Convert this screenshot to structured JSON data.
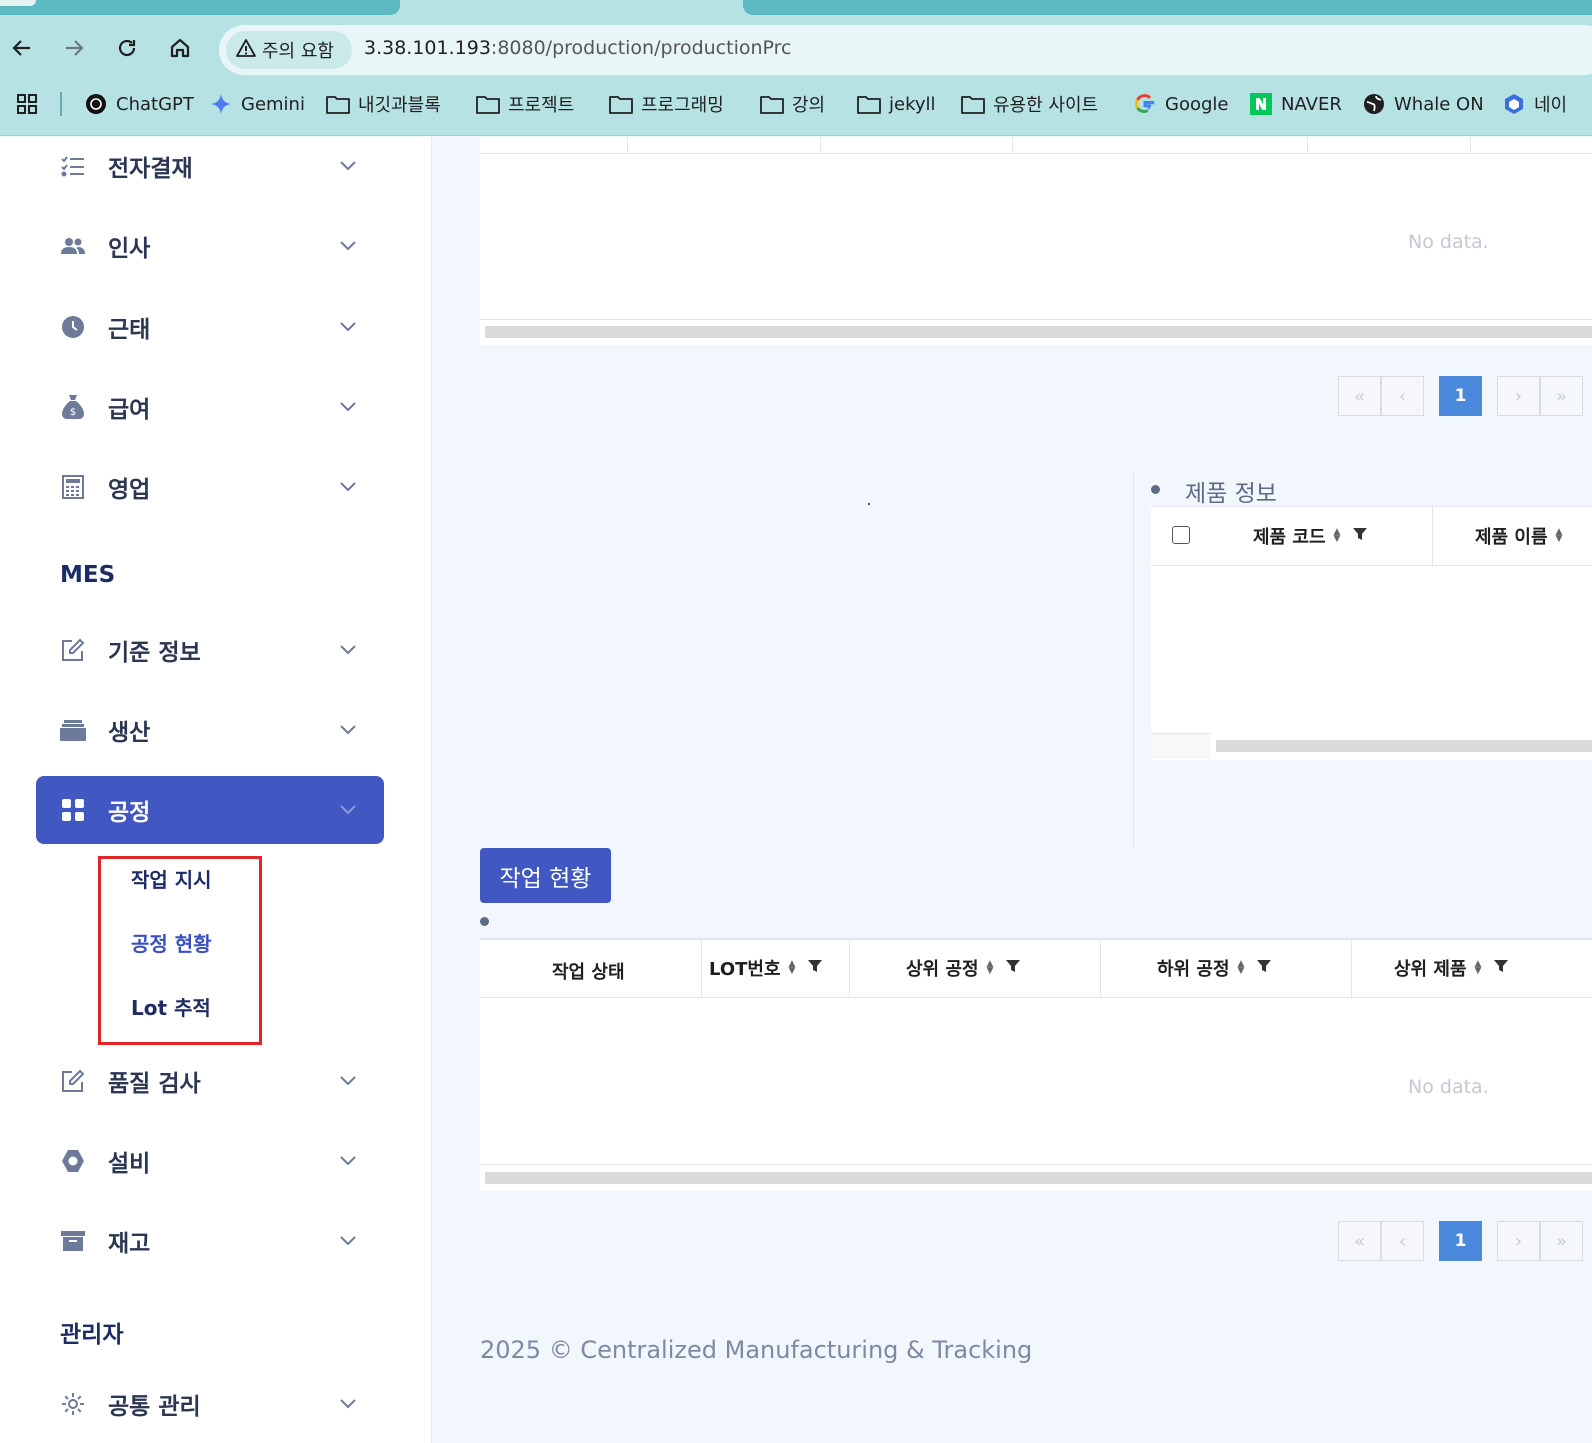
{
  "browser": {
    "security_chip": "주의 요함",
    "url_host": "3.38.101.193",
    "url_rest": ":8080/production/productionPrc",
    "bookmarks": [
      "ChatGPT",
      "Gemini",
      "내깃과블록",
      "프로젝트",
      "프로그래밍",
      "강의",
      "jekyll",
      "유용한 사이트",
      "Google",
      "NAVER",
      "Whale ON",
      "네이"
    ]
  },
  "sidebar": {
    "items_top": [
      {
        "label": "전자결재",
        "icon": "list-check-icon"
      },
      {
        "label": "인사",
        "icon": "users-icon"
      },
      {
        "label": "근태",
        "icon": "clock-icon"
      },
      {
        "label": "급여",
        "icon": "money-bag-icon"
      },
      {
        "label": "영업",
        "icon": "calculator-icon"
      }
    ],
    "section_mes": "MES",
    "items_mes": [
      {
        "label": "기준 정보",
        "icon": "edit-icon"
      },
      {
        "label": "생산",
        "icon": "briefcase-icon"
      },
      {
        "label": "공정",
        "icon": "grid-icon",
        "active": true
      }
    ],
    "submenu": [
      "작업 지시",
      "공정 현황",
      "Lot 추적"
    ],
    "items_after": [
      {
        "label": "품질 검사",
        "icon": "edit-icon"
      },
      {
        "label": "설비",
        "icon": "hexagon-icon"
      },
      {
        "label": "재고",
        "icon": "archive-icon"
      }
    ],
    "section_admin": "관리자",
    "items_admin": [
      {
        "label": "공통 관리",
        "icon": "gear-icon"
      }
    ]
  },
  "main": {
    "top_table": {
      "empty_text": "No data.",
      "pagination": {
        "current": "1"
      }
    },
    "product_info": {
      "title": "제품 정보",
      "columns": [
        "제품 코드",
        "제품 이름"
      ]
    },
    "work_status_button": "작업 현황",
    "work_table": {
      "columns": [
        "작업 상태",
        "LOT번호",
        "상위 공정",
        "하위 공정",
        "상위 제품"
      ],
      "empty_text": "No data.",
      "pagination": {
        "current": "1"
      }
    },
    "footer": "2025 © Centralized Manufacturing & Tracking"
  }
}
